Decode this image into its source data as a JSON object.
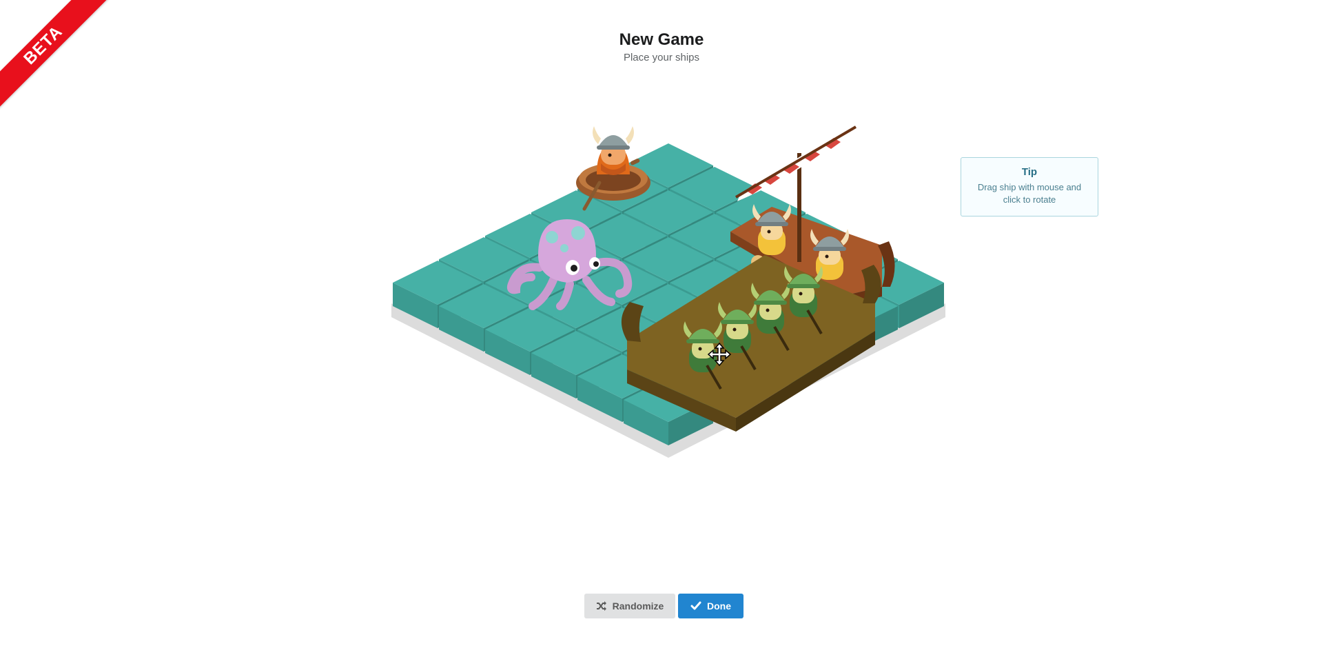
{
  "beta": {
    "label": "BETA"
  },
  "header": {
    "title": "New Game",
    "subtitle": "Place your ships"
  },
  "tip": {
    "title": "Tip",
    "text": "Drag ship with mouse and click to rotate"
  },
  "buttons": {
    "randomize": {
      "label": "Randomize",
      "icon": "shuffle-icon"
    },
    "done": {
      "label": "Done",
      "icon": "checkmark-icon"
    }
  },
  "board": {
    "rows": 6,
    "cols": 6,
    "colors": {
      "water_top": "#46b1a6",
      "water_left": "#3b9b91",
      "water_right": "#34897f",
      "base": "#dcdcdc"
    },
    "pieces": [
      "rowboat-viking",
      "kraken-octopus",
      "sail-longship",
      "rowing-longship"
    ]
  },
  "cursor": {
    "icon": "move-cursor-icon"
  },
  "colors": {
    "beta_red": "#e8101c",
    "done_blue": "#2185d0",
    "randomize_gray": "#e0e1e2",
    "tip_text": "#276f86"
  }
}
